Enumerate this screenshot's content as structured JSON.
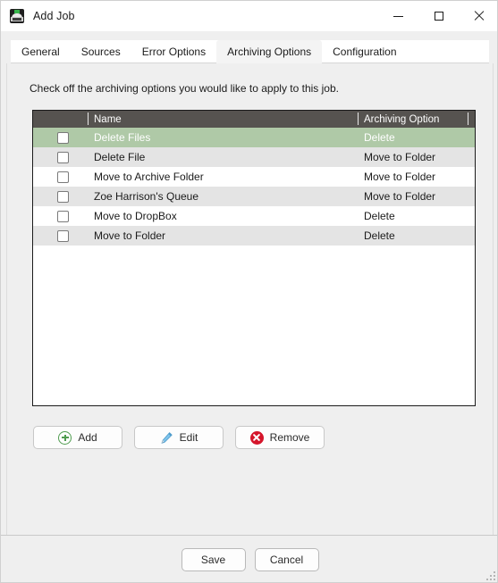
{
  "window": {
    "title": "Add Job",
    "icon": "app-dome-icon",
    "controls": {
      "minimize": "minimize-icon",
      "maximize": "maximize-icon",
      "close": "close-icon"
    }
  },
  "tabs": [
    {
      "label": "General",
      "active": false
    },
    {
      "label": "Sources",
      "active": false
    },
    {
      "label": "Error Options",
      "active": false
    },
    {
      "label": "Archiving Options",
      "active": true
    },
    {
      "label": "Configuration",
      "active": false
    }
  ],
  "main": {
    "instruction": "Check off the archiving options you would like to apply to this job."
  },
  "list": {
    "columns": [
      "",
      "Name",
      "Archiving Option",
      ""
    ],
    "header_background": "#565350",
    "selection_color": "#afc9a7",
    "rows": [
      {
        "checked": false,
        "name": "Delete Files",
        "option": "Delete",
        "selected": true
      },
      {
        "checked": false,
        "name": "Delete File",
        "option": "Move to Folder",
        "selected": false
      },
      {
        "checked": false,
        "name": "Move to Archive Folder",
        "option": "Move to Folder",
        "selected": false
      },
      {
        "checked": false,
        "name": "Zoe Harrison's Queue",
        "option": "Move to Folder",
        "selected": false
      },
      {
        "checked": false,
        "name": "Move to DropBox",
        "option": "Delete",
        "selected": false
      },
      {
        "checked": false,
        "name": "Move to Folder",
        "option": "Delete",
        "selected": false
      }
    ]
  },
  "actions": {
    "add": {
      "label": "Add",
      "icon": "plus-circle-icon",
      "color": "#4f9c4f"
    },
    "edit": {
      "label": "Edit",
      "icon": "pencil-icon",
      "color": "#5aaee0"
    },
    "remove": {
      "label": "Remove",
      "icon": "x-circle-icon",
      "color": "#d5152b"
    }
  },
  "footer": {
    "save": "Save",
    "cancel": "Cancel"
  }
}
